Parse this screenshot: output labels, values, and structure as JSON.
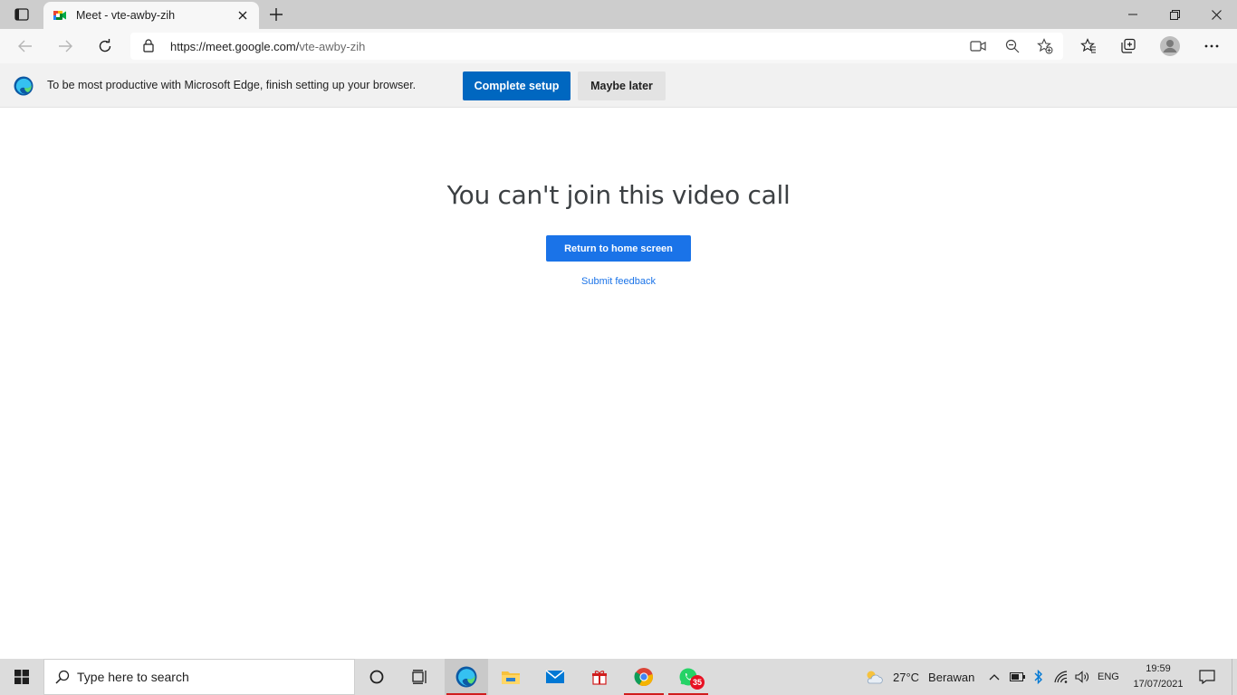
{
  "browser": {
    "tab": {
      "title": "Meet - vte-awby-zih"
    },
    "address": {
      "host": "https://meet.google.com/",
      "path": "vte-awby-zih"
    }
  },
  "infobar": {
    "message": "To be most productive with Microsoft Edge, finish setting up your browser.",
    "primary_label": "Complete setup",
    "secondary_label": "Maybe later"
  },
  "page": {
    "heading": "You can't join this video call",
    "return_label": "Return to home screen",
    "feedback_label": "Submit feedback"
  },
  "taskbar": {
    "search_placeholder": "Type here to search",
    "whatsapp_badge": "35",
    "weather_temp": "27°C",
    "weather_desc": "Berawan",
    "language": "ENG",
    "time": "19:59",
    "date": "17/07/2021"
  },
  "colors": {
    "edge_blue": "#0067c0",
    "meet_blue": "#1a73e8"
  }
}
